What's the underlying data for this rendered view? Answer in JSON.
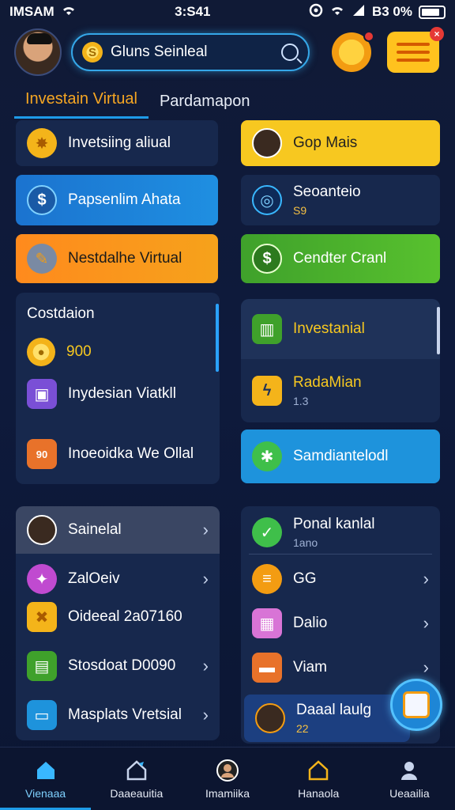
{
  "status_bar": {
    "carrier": "IMSAM",
    "time": "3:S41",
    "battery": "B3 0%"
  },
  "header": {
    "search_value": "Gluns Seinleal",
    "coin_symbol": "S"
  },
  "tabs": [
    {
      "label": "Investain Virtual",
      "active": true
    },
    {
      "label": "Pardamapon",
      "active": false
    }
  ],
  "left_cards": [
    {
      "label": "Invetsiing aliual",
      "icon": "sun-badge-icon",
      "style": "dark"
    },
    {
      "label": "Papsenlim Ahata",
      "icon": "dollar-coin-icon",
      "style": "blue"
    },
    {
      "label": "Nestdalhe Virtual",
      "icon": "pen-icon",
      "style": "orange"
    }
  ],
  "right_cards": [
    {
      "label": "Gop Mais",
      "icon": "avatar-woman-icon",
      "style": "yellow"
    },
    {
      "label": "Seoanteio",
      "sub": "S9",
      "icon": "planet-icon",
      "style": "dark"
    },
    {
      "label": "Cendter Cranl",
      "icon": "dollar-coin-icon",
      "style": "green"
    }
  ],
  "left_panel": {
    "title": "Costdaion",
    "coin_value": "900",
    "items": [
      {
        "label": "Inydesian Viatkll",
        "icon": "purple-box-icon"
      },
      {
        "label": "Inoeoidka We Ollal",
        "icon": "calendar-icon",
        "badge": "90"
      }
    ]
  },
  "right_panel": {
    "items": [
      {
        "label": "Investanial",
        "icon": "green-chart-icon"
      },
      {
        "label": "RadaMian",
        "sub": "1.3",
        "icon": "lightning-icon"
      },
      {
        "label": "Samdiantelodl",
        "icon": "gear-star-icon"
      }
    ]
  },
  "left_list": [
    {
      "label": "Sainelal",
      "icon": "avatar-man-icon"
    },
    {
      "label": "ZalOeiv",
      "icon": "purple-star-icon"
    },
    {
      "label": "Oideeal 2a07160",
      "icon": "ribbon-icon"
    },
    {
      "label": "Stosdoat D0090",
      "icon": "green-doc-icon"
    },
    {
      "label": "Masplats Vretsial",
      "icon": "screen-icon"
    }
  ],
  "right_list": [
    {
      "label": "Ponal kanlal",
      "sub": "1ano",
      "icon": "green-check-icon"
    },
    {
      "label": "GG",
      "icon": "coin-stack-icon"
    },
    {
      "label": "Dalio",
      "icon": "cube-icon"
    },
    {
      "label": "Viam",
      "icon": "folder-icon"
    },
    {
      "label": "Daaal laulg",
      "sub": "22",
      "icon": "avatar-man2-icon"
    }
  ],
  "bottom_nav": [
    {
      "label": "Vienaaa",
      "icon": "home-icon",
      "active": true
    },
    {
      "label": "Daaeauitia",
      "icon": "home-edit-icon",
      "active": false
    },
    {
      "label": "Imamiika",
      "icon": "profile-icon",
      "active": false
    },
    {
      "label": "Hanaola",
      "icon": "house-outline-icon",
      "active": false
    },
    {
      "label": "Ueaailia",
      "icon": "user-icon",
      "active": false
    }
  ],
  "colors": {
    "accent_blue": "#1e9be8",
    "accent_orange": "#f6a623",
    "background": "#101a36"
  }
}
